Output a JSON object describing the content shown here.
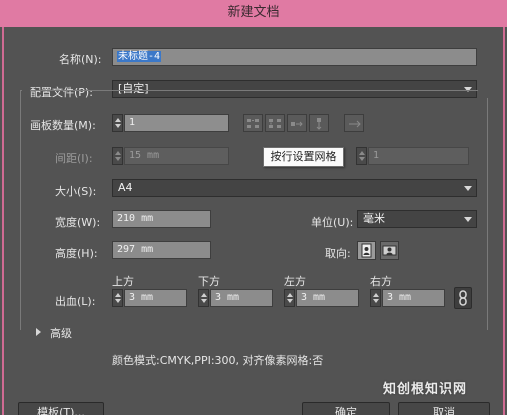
{
  "window": {
    "title": "新建文档"
  },
  "form": {
    "name_label": "名称(N):",
    "name_value": "未标题-4",
    "profile_label": "配置文件(P):",
    "profile_value": "[自定]",
    "artboards_label": "画板数量(M):",
    "artboards_value": "1",
    "spacing_label": "间距(I):",
    "spacing_value": "15 mm",
    "columns_value": "1",
    "size_label": "大小(S):",
    "size_value": "A4",
    "width_label": "宽度(W):",
    "width_value": "210 mm",
    "units_label": "单位(U):",
    "units_value": "毫米",
    "height_label": "高度(H):",
    "height_value": "297 mm",
    "orientation_label": "取向:",
    "bleed_label": "出血(L):",
    "bleed_top_label": "上方",
    "bleed_top_value": "3 mm",
    "bleed_bottom_label": "下方",
    "bleed_bottom_value": "3 mm",
    "bleed_left_label": "左方",
    "bleed_left_value": "3 mm",
    "bleed_right_label": "右方",
    "bleed_right_value": "3 mm",
    "advanced_label": "高级",
    "summary": "颜色模式:CMYK,PPI:300, 对齐像素网格:否"
  },
  "tooltip": {
    "text": "按行设置网格"
  },
  "buttons": {
    "template": "模板(T)...",
    "ok": "确定",
    "cancel": "取消"
  },
  "watermark": {
    "text": "知创根知识网"
  },
  "colors": {
    "titlebar": "#e07aa3",
    "dialog_bg": "#535353",
    "selection": "#3b78c8"
  },
  "icons": {
    "grid_by_row": "grid-by-row-icon",
    "grid_by_column": "grid-by-column-icon",
    "arrange_by_row": "arrange-by-row-icon",
    "arrange_by_column": "arrange-by-column-icon",
    "right_to_left": "right-to-left-icon",
    "portrait": "portrait-icon",
    "landscape": "landscape-icon",
    "link": "link-icon",
    "expand": "triangle-right-icon"
  }
}
